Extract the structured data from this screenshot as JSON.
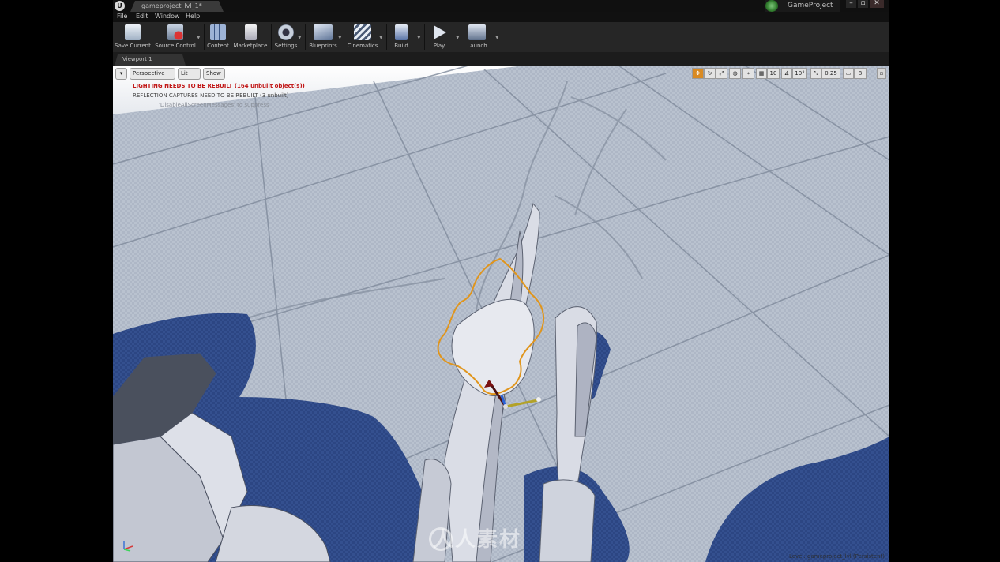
{
  "window": {
    "tab_title": "gameproject_lvl_1*",
    "project_name": "GameProject",
    "min_glyph": "–",
    "max_glyph": "▫",
    "close_glyph": "✕",
    "logo_glyph": "U"
  },
  "menu": [
    "File",
    "Edit",
    "Window",
    "Help"
  ],
  "toolbar": {
    "items": [
      {
        "label": "Save Current",
        "icon": "save-icon"
      },
      {
        "label": "Source Control",
        "icon": "source-control-icon"
      },
      {
        "label": "Content",
        "icon": "content-icon"
      },
      {
        "label": "Marketplace",
        "icon": "marketplace-icon"
      },
      {
        "label": "Settings",
        "icon": "settings-icon"
      },
      {
        "label": "Blueprints",
        "icon": "blueprints-icon"
      },
      {
        "label": "Cinematics",
        "icon": "cinematics-icon"
      },
      {
        "label": "Build",
        "icon": "build-icon"
      },
      {
        "label": "Play",
        "icon": "play-icon"
      },
      {
        "label": "Launch",
        "icon": "launch-icon"
      }
    ]
  },
  "viewport": {
    "tab_label": "Viewport 1",
    "menu_glyph": "▾",
    "perspective": "Perspective",
    "lit": "Lit",
    "show": "Show",
    "warning_lighting": "LIGHTING NEEDS TO BE REBUILT (164 unbuilt object(s))",
    "warning_reflection": "REFLECTION CAPTURES NEED TO BE REBUILT (3 unbuilt)",
    "disable_hint": "'DisableAllScreenMessages' to suppress",
    "grid_snap": "10",
    "rotation_snap": "10°",
    "scale_snap": "0.25",
    "camera_speed": "8",
    "level_label": "Level:  gameproject_lvl (Persistent)",
    "watermark": "人人素材"
  },
  "colors": {
    "accent": "#d98a22",
    "warning": "#c11616",
    "selection_outline": "#e0951c",
    "shadow": "#2f4a8a",
    "floor": "#b7c0cd"
  }
}
